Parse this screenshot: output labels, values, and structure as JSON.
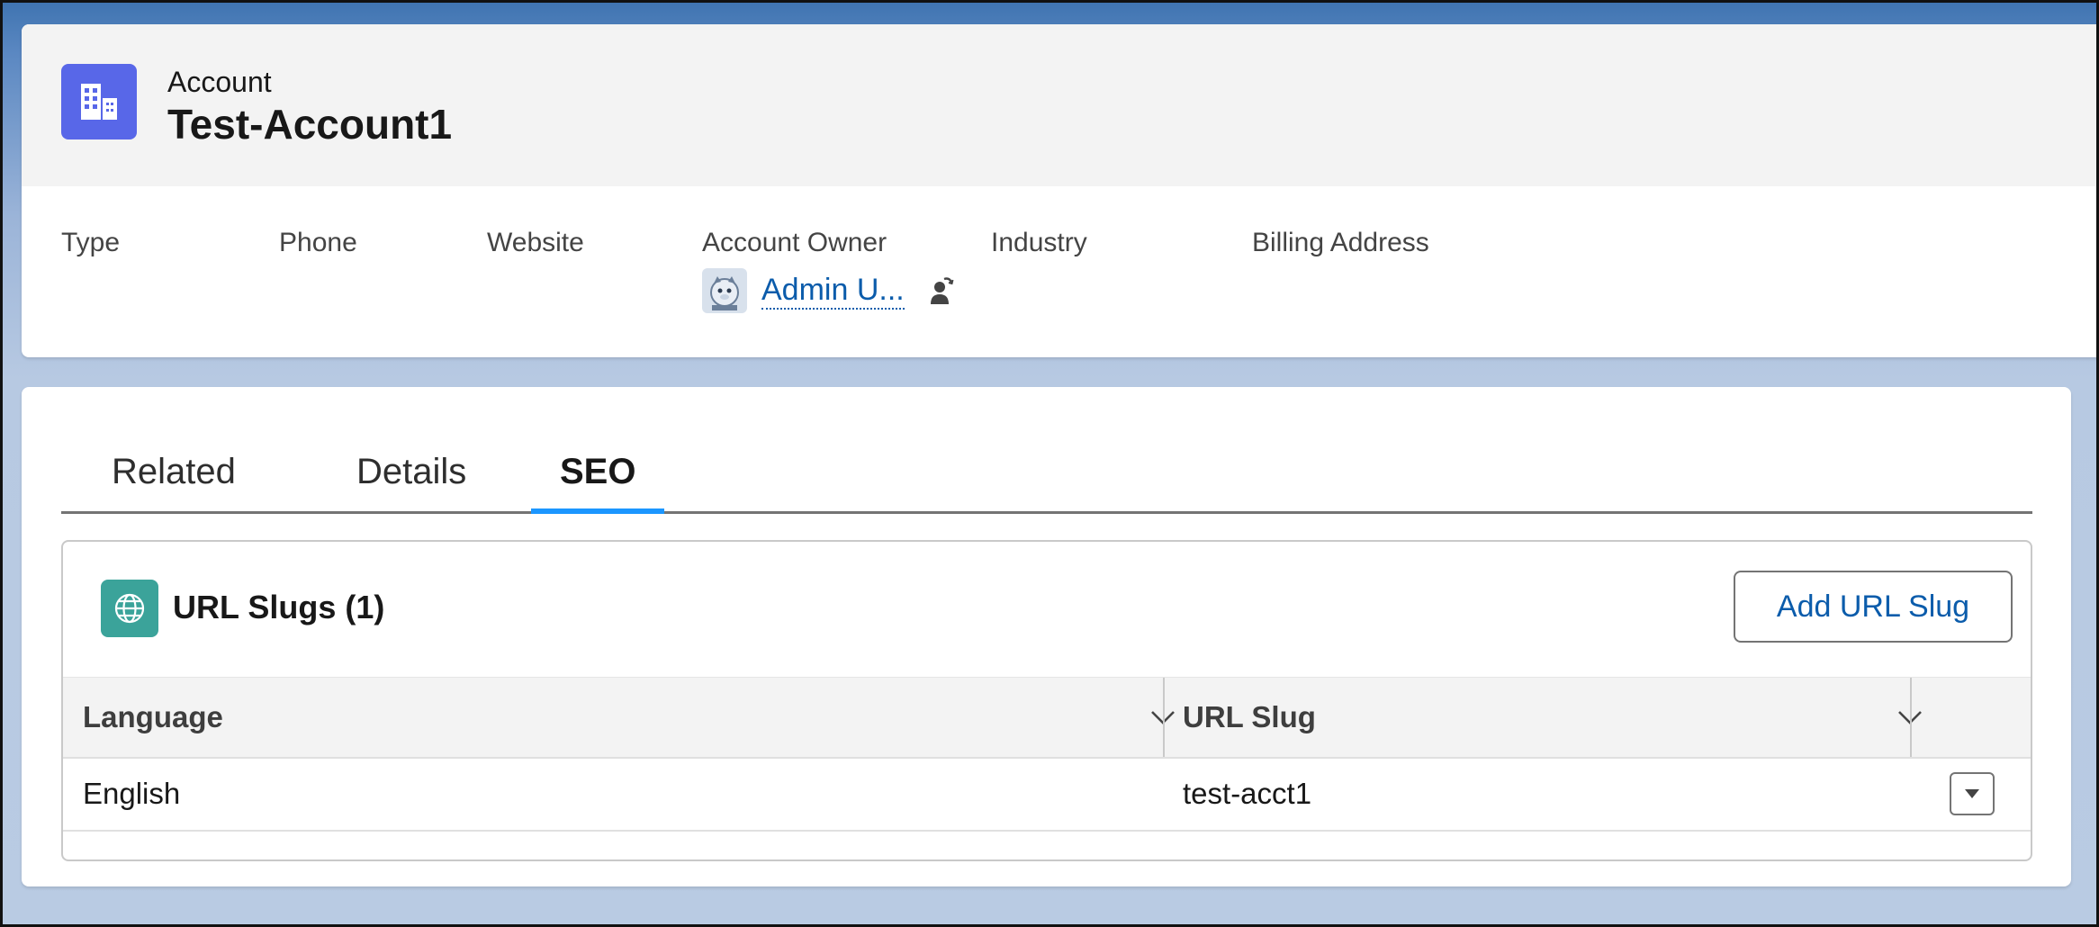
{
  "record": {
    "object_type": "Account",
    "name": "Test-Account1",
    "icon": "account-building-icon"
  },
  "highlights": {
    "fields": [
      {
        "label": "Type",
        "value": ""
      },
      {
        "label": "Phone",
        "value": ""
      },
      {
        "label": "Website",
        "value": ""
      },
      {
        "label": "Account Owner",
        "value": "Admin U..."
      },
      {
        "label": "Industry",
        "value": ""
      },
      {
        "label": "Billing Address",
        "value": ""
      }
    ],
    "owner_avatar_icon": "user-avatar-icon",
    "change_owner_icon": "change-owner-icon"
  },
  "tabs": [
    {
      "label": "Related",
      "active": false
    },
    {
      "label": "Details",
      "active": false
    },
    {
      "label": "SEO",
      "active": true
    }
  ],
  "related_list": {
    "icon": "globe-icon",
    "title": "URL Slugs (1)",
    "add_button": "Add URL Slug",
    "columns": [
      "Language",
      "URL Slug"
    ],
    "rows": [
      {
        "language": "English",
        "url_slug": "test-acct1"
      }
    ]
  },
  "colors": {
    "accent": "#0b5cab",
    "active_tab": "#1b96ff",
    "account_icon_bg": "#5867e8",
    "url_slug_icon_bg": "#3ba39a"
  }
}
